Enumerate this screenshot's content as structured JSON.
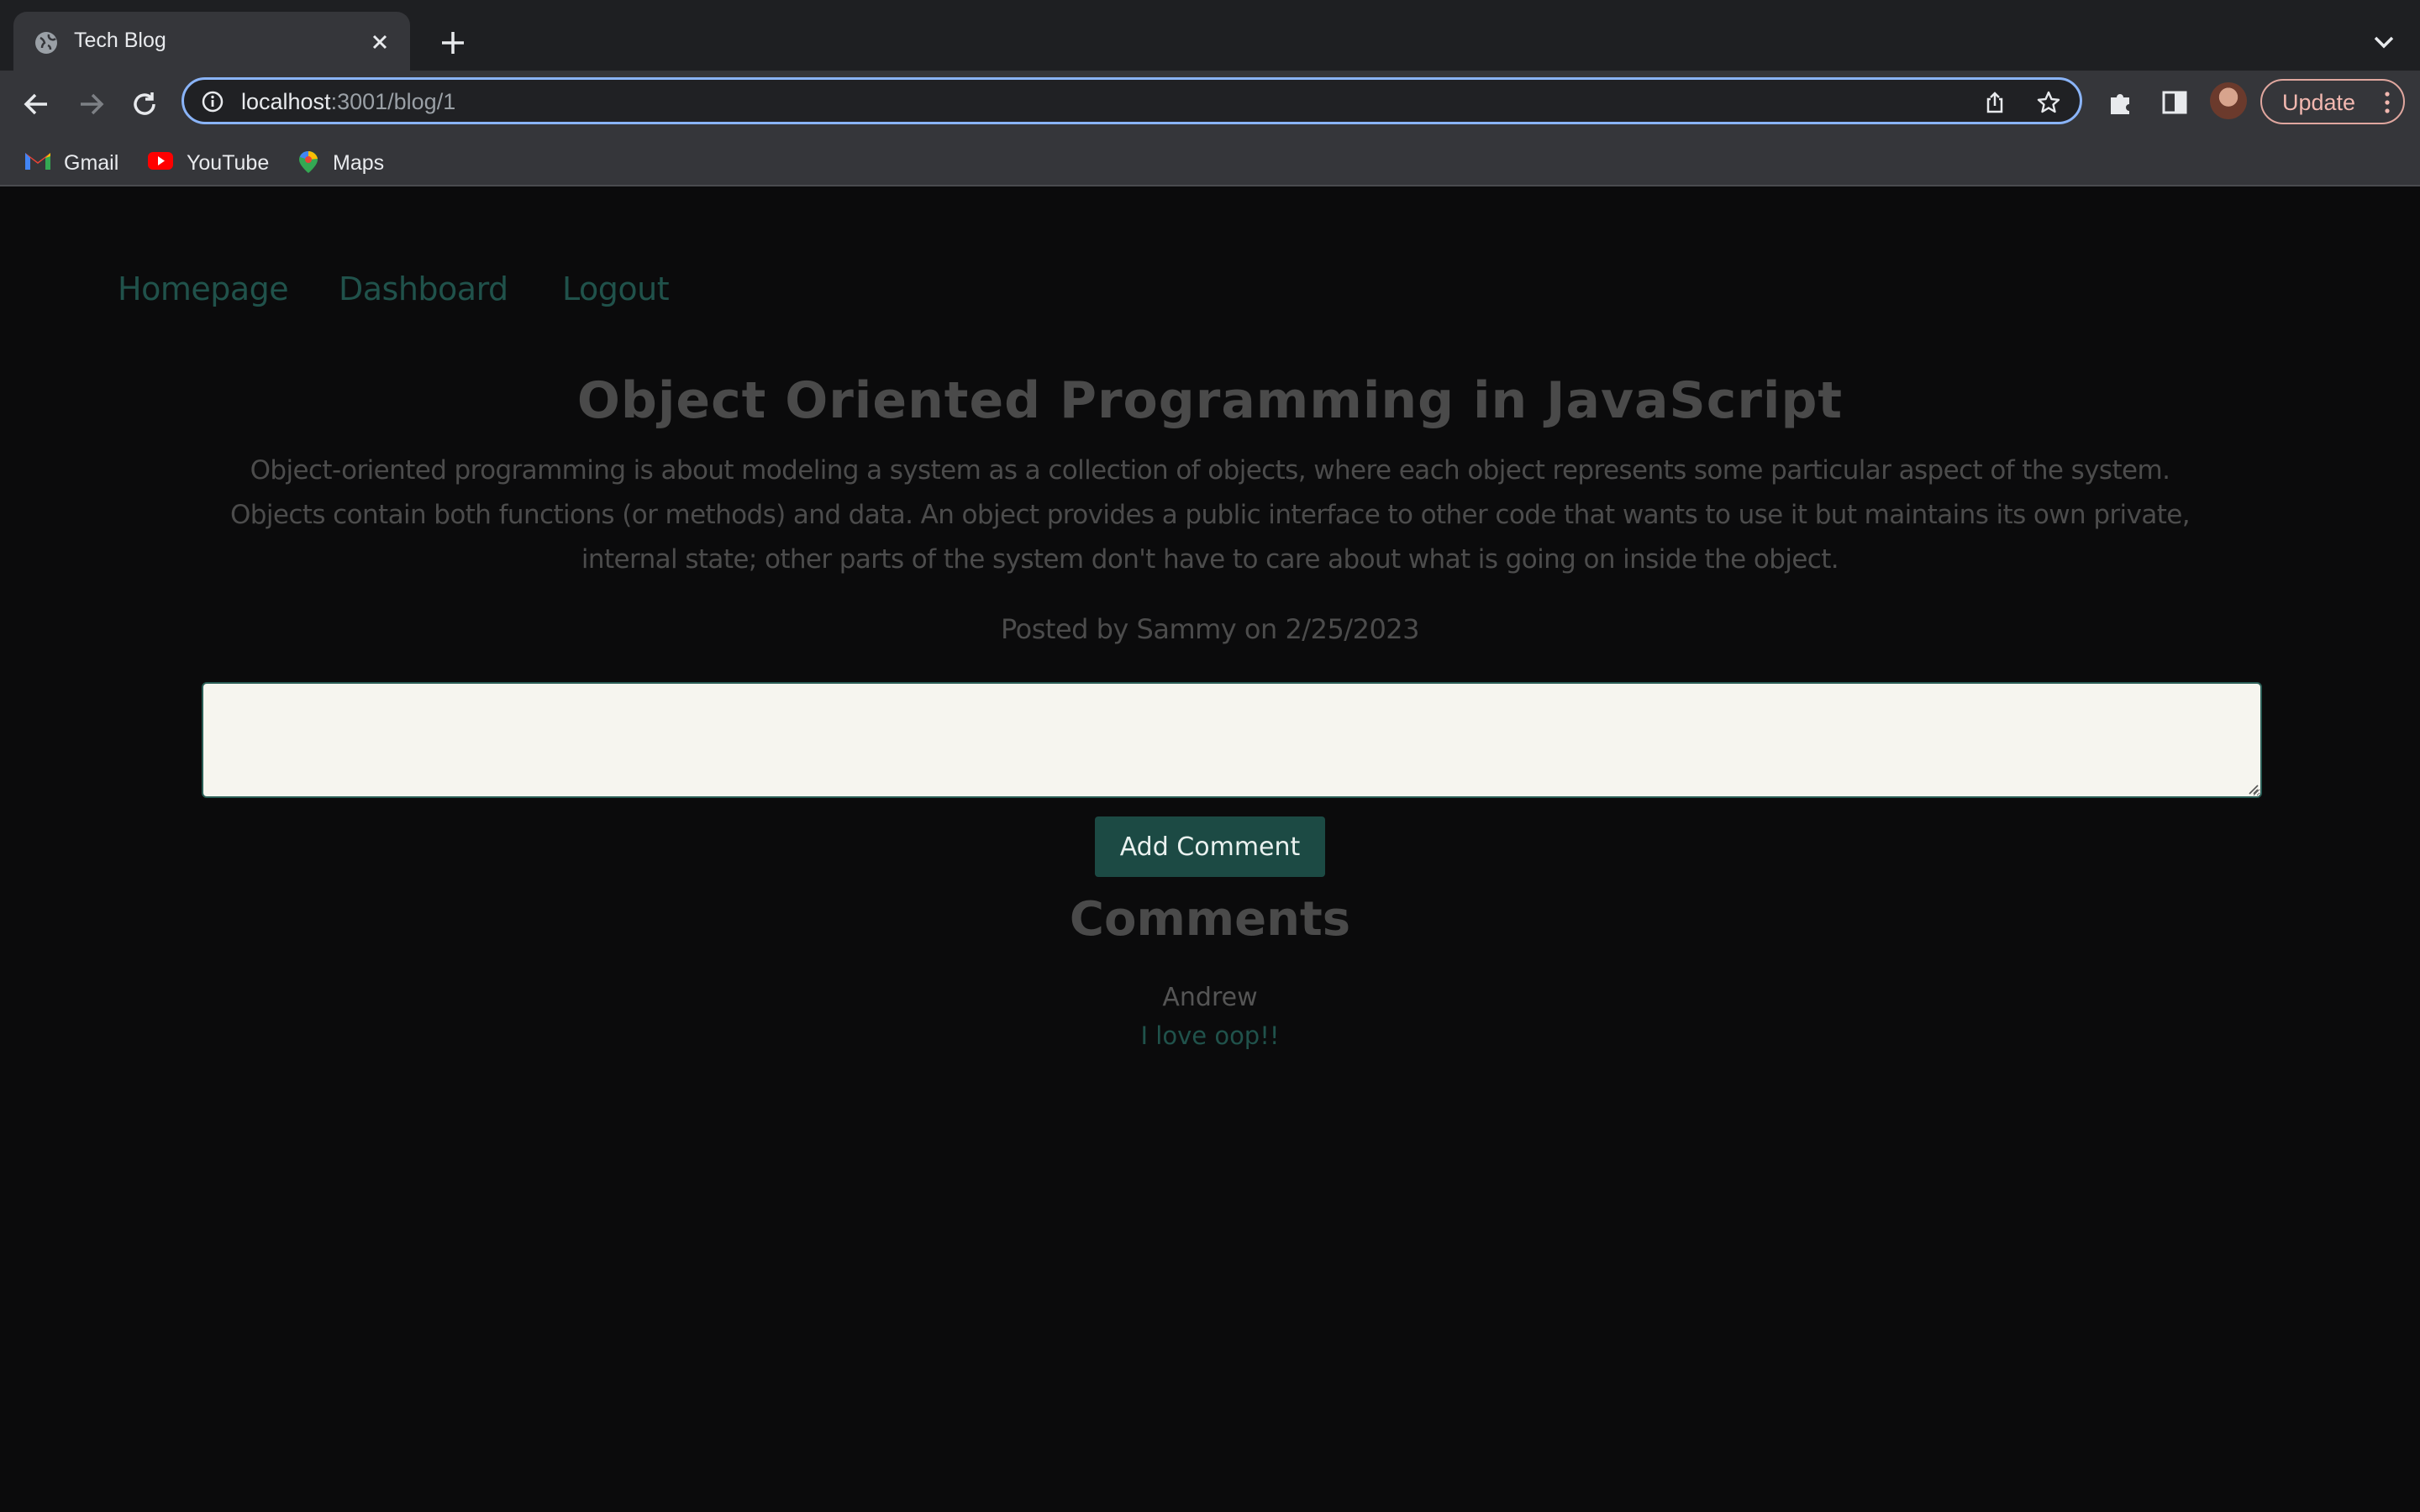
{
  "browser": {
    "tab_title": "Tech Blog",
    "url_host": "localhost",
    "url_path": ":3001/blog/1",
    "update_label": "Update",
    "bookmarks": [
      {
        "label": "Gmail",
        "icon": "gmail-icon"
      },
      {
        "label": "YouTube",
        "icon": "youtube-icon"
      },
      {
        "label": "Maps",
        "icon": "maps-icon"
      }
    ]
  },
  "nav": {
    "homepage": "Homepage",
    "dashboard": "Dashboard",
    "logout": "Logout"
  },
  "post": {
    "title": "Object Oriented Programming in JavaScript",
    "body": "Object-oriented programming is about modeling a system as a collection of objects, where each object represents some particular aspect of the system. Objects contain both functions (or methods) and data. An object provides a public interface to other code that wants to use it but maintains its own private, internal state; other parts of the system don't have to care about what is going on inside the object.",
    "meta": "Posted by Sammy on 2/25/2023"
  },
  "comment_form": {
    "textarea_value": "",
    "submit_label": "Add Comment"
  },
  "comments": {
    "heading": "Comments",
    "items": [
      {
        "author": "Andrew",
        "text": "I love oop!!"
      }
    ]
  },
  "colors": {
    "page_background": "#0b0b0c",
    "link": "#20524b",
    "button": "#1c4a44",
    "omnibox_focus": "#8ab4f8"
  }
}
